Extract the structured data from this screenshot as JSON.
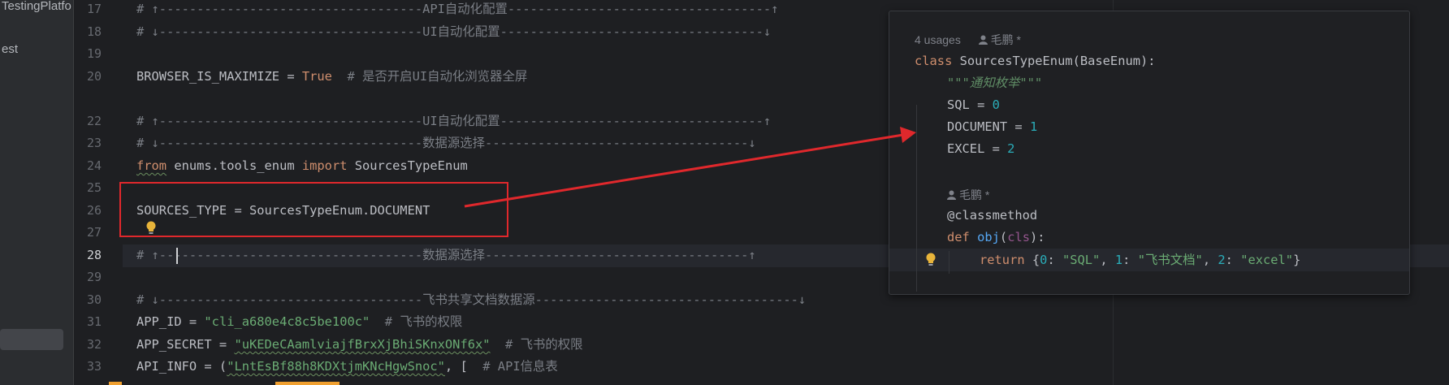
{
  "project_panel": {
    "title_fragment": "TestingPlatfo",
    "item_fragment": "est"
  },
  "editor": {
    "line_numbers": [
      "17",
      "18",
      "19",
      "20",
      "22",
      "23",
      "24",
      "25",
      "26",
      "27",
      "28",
      "29",
      "30",
      "31",
      "32",
      "33"
    ],
    "lines": {
      "l17_comment": "# ↑-----------------------------------API自动化配置-----------------------------------↑",
      "l18_comment": "# ↓-----------------------------------UI自动化配置-----------------------------------↓",
      "l20_var": "BROWSER_IS_MAXIMIZE = ",
      "l20_value": "True",
      "l20_comment": "  # 是否开启UI自动化浏览器全屏",
      "l22_comment": "# ↑-----------------------------------UI自动化配置-----------------------------------↑",
      "l23_comment": "# ↓-----------------------------------数据源选择-----------------------------------↓",
      "l24_from": "from",
      "l24_module": " enums.tools_enum ",
      "l24_import": "import",
      "l24_name": " SourcesTypeEnum",
      "l26_code": "SOURCES_TYPE = SourcesTypeEnum.DOCUMENT",
      "l28_comment": "# ↑-----------------------------------数据源选择-----------------------------------↑",
      "l30_comment": "# ↓-----------------------------------飞书共享文档数据源-----------------------------------↓",
      "l31_var": "APP_ID = ",
      "l31_value": "\"cli_a680e4c8c5be100c\"",
      "l31_comment": "  # 飞书的权限",
      "l32_var": "APP_SECRET = ",
      "l32_value": "\"uKEDeCAamlviajfBrxXjBhiSKnxONf6x\"",
      "l32_comment": "  # 飞书的权限",
      "l33_var": "API_INFO = (",
      "l33_value": "\"LntEsBf88h8KDXtjmKNcHgwSnoc\"",
      "l33_rest": ", [",
      "l33_comment": "  # API信息表"
    }
  },
  "popup": {
    "usages": "4 usages",
    "author1": "毛鹏 *",
    "class_kw": "class",
    "class_name": " SourcesTypeEnum(BaseEnum):",
    "docstring": "\"\"\"通知枚举\"\"\"",
    "sql_name": "SQL = ",
    "sql_val": "0",
    "doc_name": "DOCUMENT = ",
    "doc_val": "1",
    "excel_name": "EXCEL = ",
    "excel_val": "2",
    "author2": "毛鹏 *",
    "decorator": "@classmethod",
    "def_kw": "def",
    "fn_name": "obj",
    "fn_open": "(",
    "fn_param": "cls",
    "fn_close": "):",
    "return_kw": "return",
    "ret_open": " {",
    "ret_k0": "0",
    "ret_v0": "\"SQL\"",
    "ret_k1": "1",
    "ret_v1": "\"飞书文档\"",
    "ret_k2": "2",
    "ret_v2": "\"excel\"",
    "ret_close": "}",
    "colon_sep": ": ",
    "comma_sep": ", "
  },
  "colors": {
    "annotation_red": "#e0282c",
    "keyword": "#cf8e6d",
    "string": "#6aab73",
    "number": "#2aacb8"
  }
}
